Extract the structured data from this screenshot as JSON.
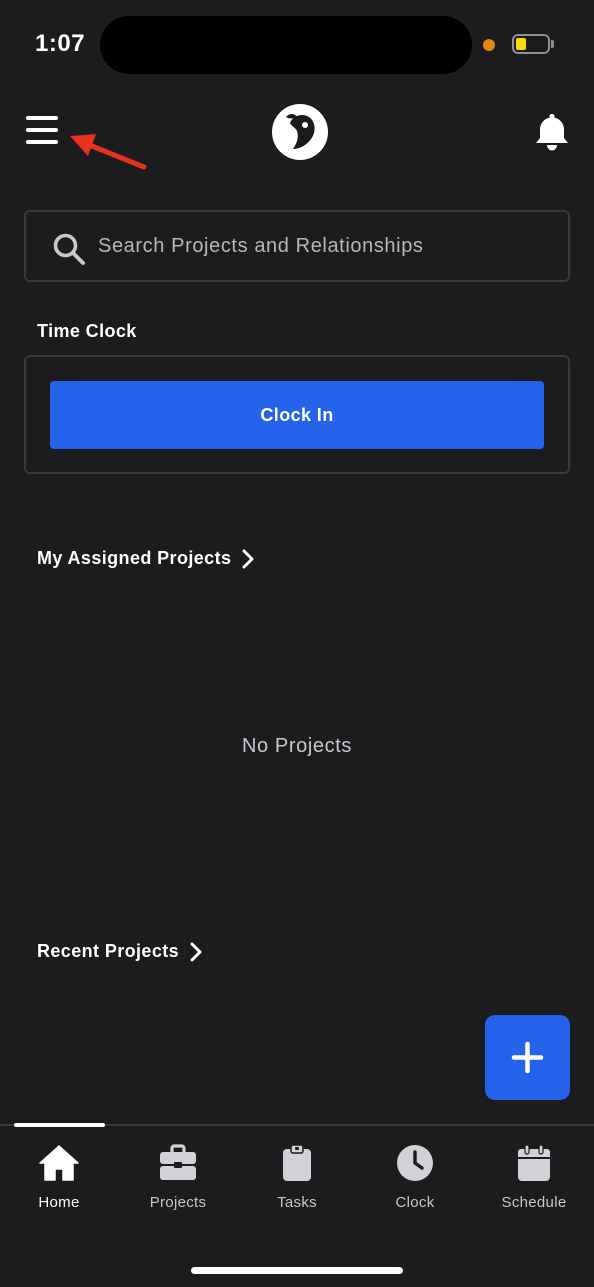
{
  "status_bar": {
    "time": "1:07"
  },
  "header": {
    "menu_icon": "hamburger-menu-icon",
    "logo_icon": "app-logo",
    "bell_icon": "bell-icon",
    "annotation_color": "#e8321e"
  },
  "search": {
    "placeholder": "Search Projects and Relationships",
    "icon": "search-icon"
  },
  "time_clock": {
    "title": "Time Clock",
    "button_label": "Clock In"
  },
  "assigned_projects": {
    "title": "My Assigned Projects",
    "empty_text": "No Projects"
  },
  "recent_projects": {
    "title": "Recent Projects"
  },
  "fab": {
    "icon": "plus-icon"
  },
  "colors": {
    "accent": "#2563eb",
    "background": "#1c1c1e",
    "border": "#3a3a3e"
  },
  "tabs": [
    {
      "label": "Home",
      "icon": "home-icon",
      "active": true
    },
    {
      "label": "Projects",
      "icon": "briefcase-icon",
      "active": false
    },
    {
      "label": "Tasks",
      "icon": "clipboard-icon",
      "active": false
    },
    {
      "label": "Clock",
      "icon": "clock-icon",
      "active": false
    },
    {
      "label": "Schedule",
      "icon": "calendar-icon",
      "active": false
    }
  ]
}
